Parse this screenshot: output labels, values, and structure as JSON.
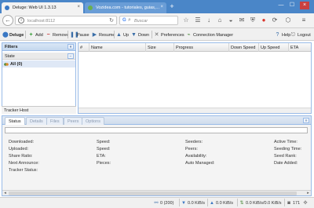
{
  "browser": {
    "tabs": [
      {
        "title": "Deluge: Web UI 1.3.13",
        "close": "×"
      },
      {
        "title": "Vozidea.com - tutoriales, guias,...",
        "close": "×"
      }
    ],
    "new_tab": "+",
    "window_controls": [
      "—",
      "☐",
      "×"
    ],
    "url": "localhost:8112",
    "search_placeholder": "Buscar",
    "colors": {
      "tabstrip": "#4a86c8",
      "deluge_favicon": "#3a78c4",
      "vozidea_favicon": "#6ab04c",
      "abp_red": "#d9342b"
    }
  },
  "toolbar": {
    "logo_label": "Deluge",
    "add": "Add",
    "remove": "Remove",
    "pause": "Pause",
    "resume": "Resume",
    "up": "Up",
    "down": "Down",
    "preferences": "Preferences",
    "connection_manager": "Connection Manager",
    "help": "Help",
    "logout": "Logout"
  },
  "filters": {
    "title": "Filters",
    "collapse": "«",
    "state_header": "State",
    "state_collapse": "−",
    "all_label": "All (0)",
    "tracker_host": "Tracker Host"
  },
  "grid": {
    "columns": [
      "#",
      "Name",
      "Size",
      "Progress",
      "Down Speed",
      "Up Speed",
      "ETA"
    ]
  },
  "details": {
    "tabs": [
      "Status",
      "Details",
      "Files",
      "Peers",
      "Options"
    ],
    "active_tab": "Status",
    "collapse": "»",
    "status_labels": {
      "col1": [
        "Downloaded:",
        "Uploaded:",
        "Share Ratio:",
        "Next Announce:",
        "Tracker Status:"
      ],
      "col2": [
        "Speed:",
        "Speed:",
        "ETA:",
        "Pieces:"
      ],
      "col3": [
        "Seeders:",
        "Peers:",
        "Availability:",
        "Auto Managed:"
      ],
      "col4": [
        "Active Time:",
        "Seeding Time:",
        "Seed Rank:",
        "Date Added:"
      ]
    }
  },
  "statusbar": {
    "connections": "0 (200)",
    "down": "0.0 KiB/s",
    "up": "0.0 KiB/s",
    "traffic": "0.0 KiB/s/0.0 KiB/s",
    "free_space": "171",
    "dht": ""
  }
}
